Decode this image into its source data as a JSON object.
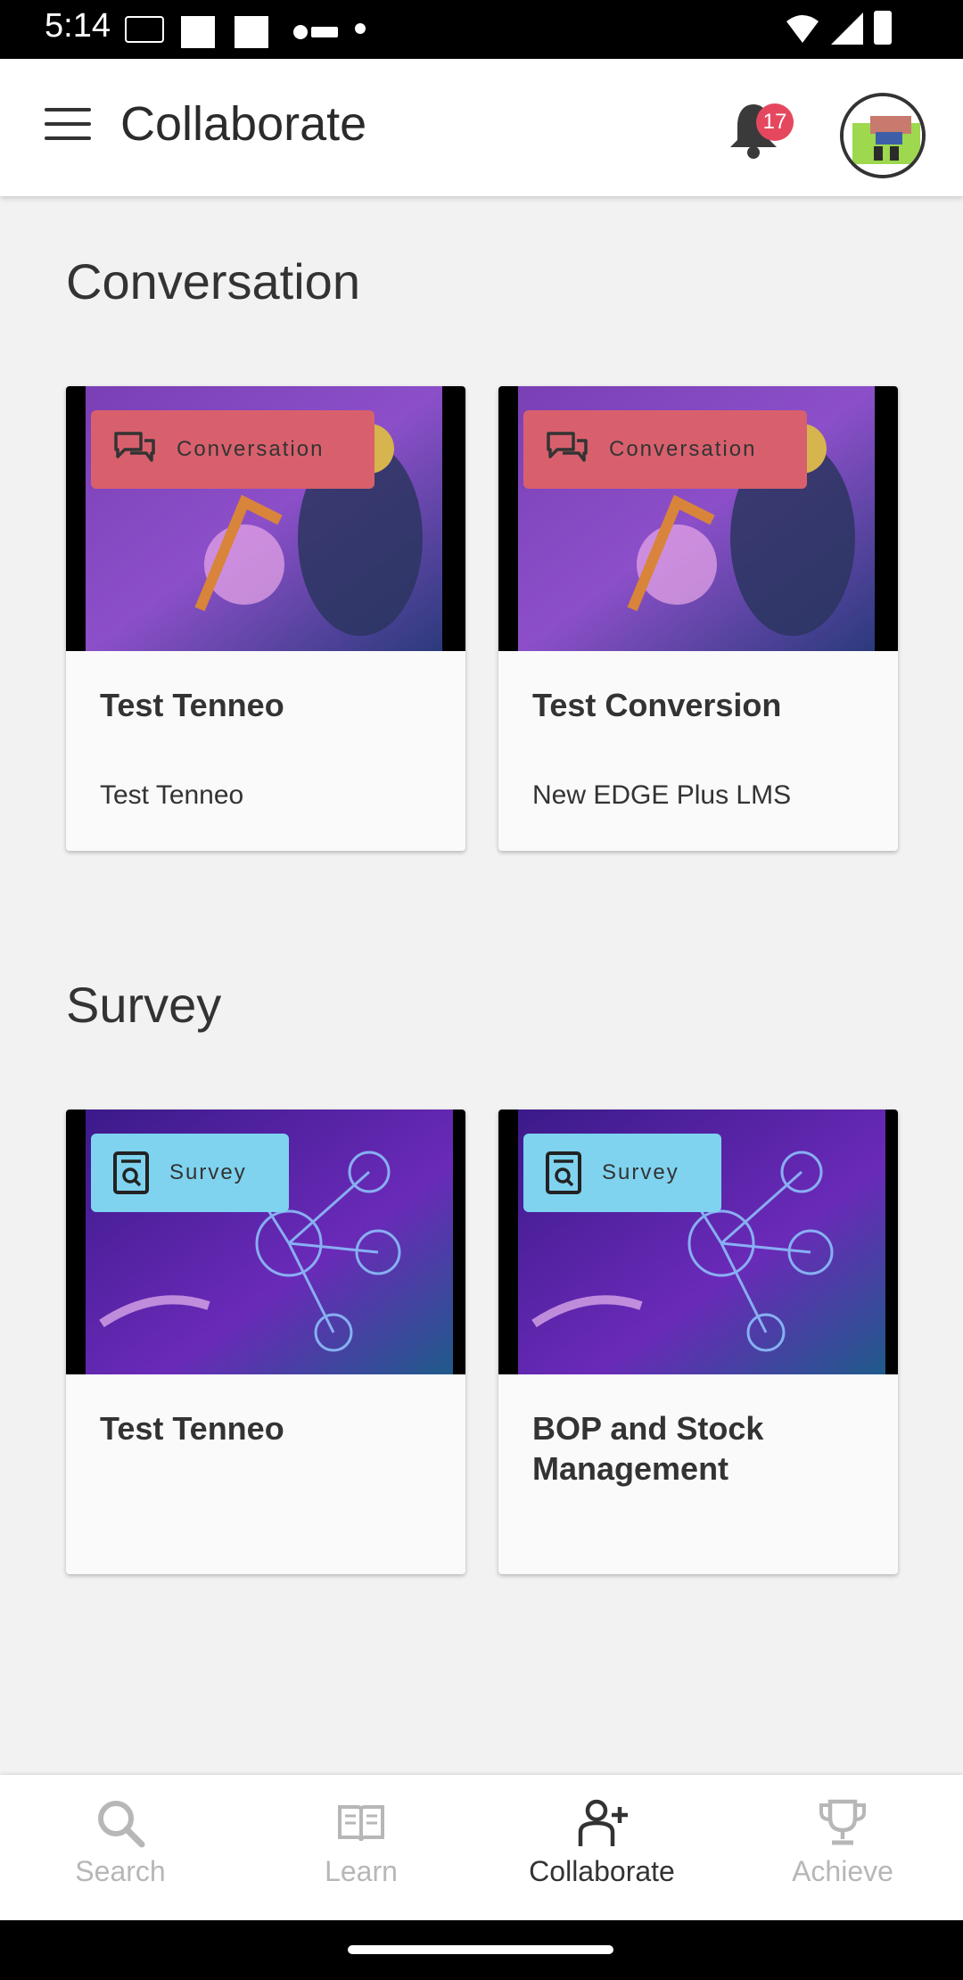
{
  "status_bar": {
    "time": "5:14"
  },
  "app_bar": {
    "title": "Collaborate",
    "notification_count": "17"
  },
  "sections": [
    {
      "title": "Conversation",
      "cards": [
        {
          "tag": "Conversation",
          "title": "Test Tenneo",
          "subtitle": "Test Tenneo",
          "image": "factory-robot-image"
        },
        {
          "tag": "Conversation",
          "title": "Test Conversion",
          "subtitle": "New EDGE Plus LMS",
          "image": "factory-robot-image"
        }
      ]
    },
    {
      "title": "Survey",
      "cards": [
        {
          "tag": "Survey",
          "title": "Test Tenneo",
          "subtitle": "",
          "image": "network-icons-image"
        },
        {
          "tag": "Survey",
          "title": "BOP and Stock Management",
          "subtitle": "",
          "image": "network-icons-image"
        }
      ]
    }
  ],
  "bottom_nav": [
    {
      "label": "Search",
      "icon": "search-icon",
      "active": false
    },
    {
      "label": "Learn",
      "icon": "book-icon",
      "active": false
    },
    {
      "label": "Collaborate",
      "icon": "add-person-icon",
      "active": true
    },
    {
      "label": "Achieve",
      "icon": "trophy-icon",
      "active": false
    }
  ],
  "colors": {
    "conversation_tag": "#d8606d",
    "survey_tag": "#7fd3ef",
    "badge": "#e5485e",
    "background": "#f2f2f3"
  }
}
